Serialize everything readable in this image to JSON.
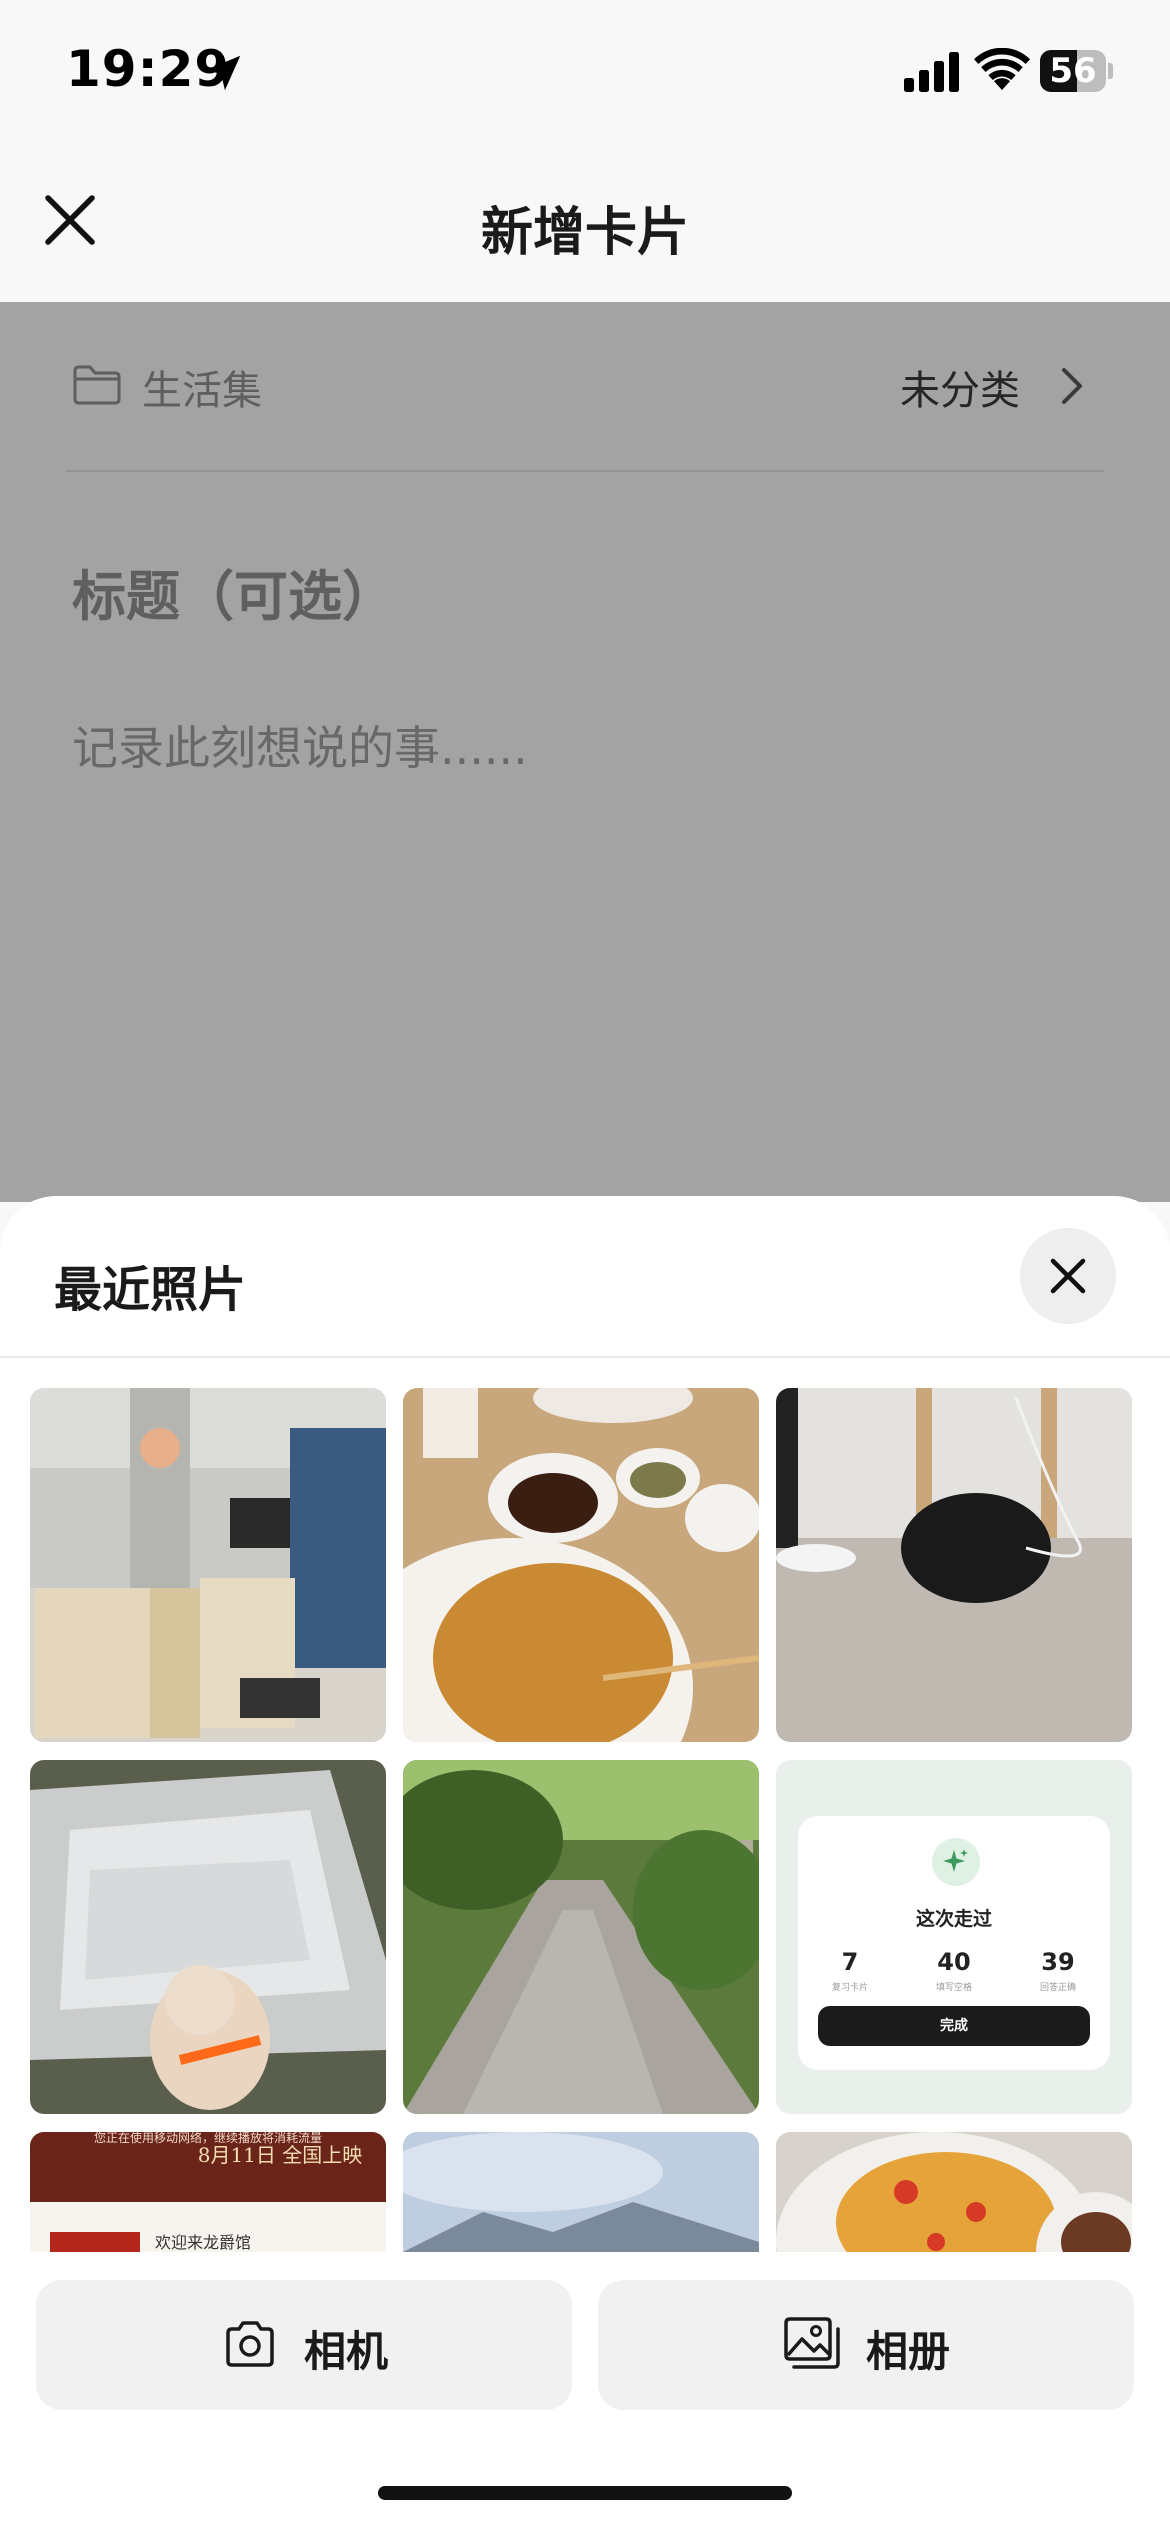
{
  "status_bar": {
    "time": "19:29",
    "battery_level": "56",
    "battery_fraction": 0.56
  },
  "header": {
    "title": "新增卡片"
  },
  "form": {
    "collection_label": "生活集",
    "category_value": "未分类",
    "title_placeholder": "标题（可选）",
    "body_placeholder": "记录此刻想说的事......"
  },
  "sheet": {
    "title": "最近照片",
    "card_preview": {
      "title": "这次走过",
      "stats": [
        {
          "value": "7",
          "label": "复习卡片"
        },
        {
          "value": "40",
          "label": "填写空格"
        },
        {
          "value": "39",
          "label": "回答正确"
        }
      ],
      "button": "完成"
    },
    "poster_preview": {
      "headline": "8月11日 全国上映",
      "notice": "您正在使用移动网络，继续播放将消耗流量",
      "box_text": "欢迎来龙爵馆"
    }
  },
  "footer": {
    "camera_label": "相机",
    "album_label": "相册"
  },
  "icons": [
    "location-arrow-icon",
    "cellular-signal-icon",
    "wifi-icon",
    "close-icon",
    "folder-icon",
    "chevron-right-icon",
    "camera-icon",
    "photo-album-icon",
    "sparkle-icon"
  ]
}
